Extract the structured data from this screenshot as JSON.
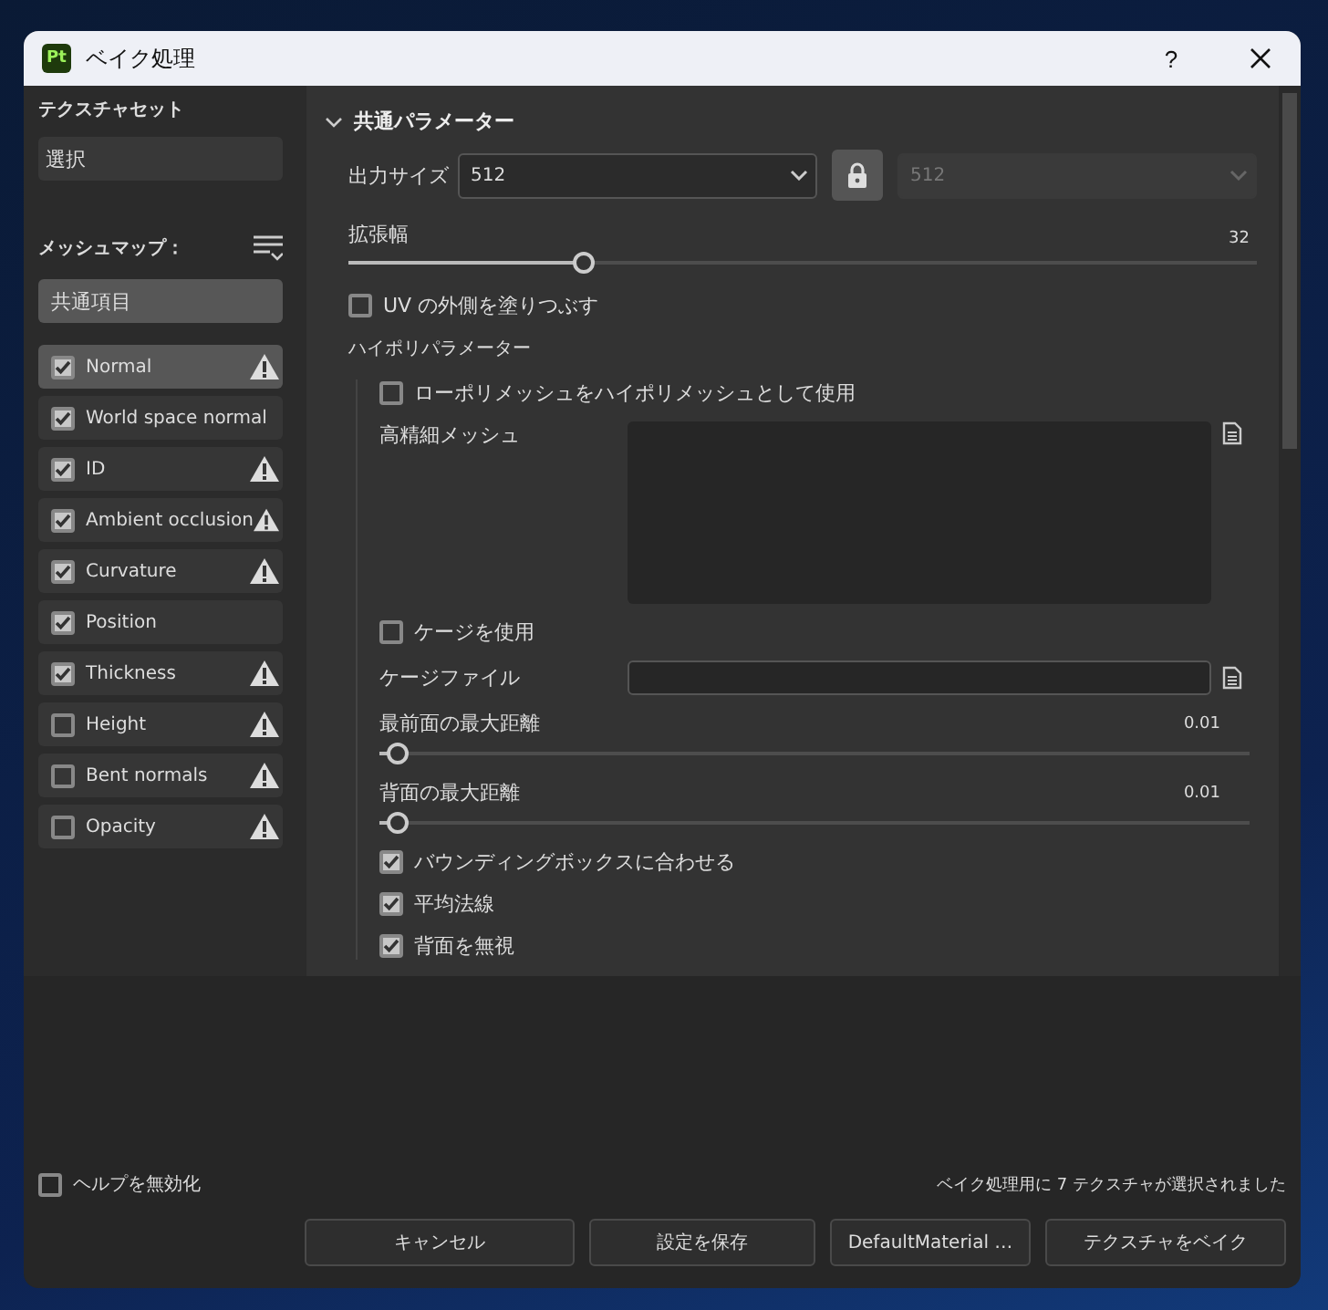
{
  "window": {
    "title": "ベイク処理",
    "logo": "Pt",
    "help": "?"
  },
  "sidebar": {
    "texture_set_label": "テクスチャセット",
    "texture_set_value": "選択",
    "mesh_maps_label": "メッシュマップ：",
    "common_item": {
      "label": "共通項目",
      "selected": true
    },
    "maps": [
      {
        "label": "Normal",
        "checked": true,
        "selected": true,
        "warning": true
      },
      {
        "label": "World space normal",
        "checked": true,
        "selected": false,
        "warning": false
      },
      {
        "label": "ID",
        "checked": true,
        "selected": false,
        "warning": true
      },
      {
        "label": "Ambient occlusion",
        "checked": true,
        "selected": false,
        "warning": true
      },
      {
        "label": "Curvature",
        "checked": true,
        "selected": false,
        "warning": true
      },
      {
        "label": "Position",
        "checked": true,
        "selected": false,
        "warning": false
      },
      {
        "label": "Thickness",
        "checked": true,
        "selected": false,
        "warning": true
      },
      {
        "label": "Height",
        "checked": false,
        "selected": false,
        "warning": true
      },
      {
        "label": "Bent normals",
        "checked": false,
        "selected": false,
        "warning": true
      },
      {
        "label": "Opacity",
        "checked": false,
        "selected": false,
        "warning": true
      }
    ]
  },
  "section": {
    "title": "共通パラメーター",
    "expanded": true
  },
  "output_size": {
    "label": "出力サイズ",
    "value": "512",
    "locked": true,
    "linked_value": "512"
  },
  "dilation": {
    "label": "拡張幅",
    "value": "32",
    "level": 0.26
  },
  "fill_uv": {
    "label": "UV の外側を塗りつぶす",
    "checked": false
  },
  "high_poly": {
    "title": "ハイポリパラメーター",
    "use_low_as_high": {
      "label": "ローポリメッシュをハイポリメッシュとして使用",
      "checked": false
    },
    "mesh_label": "高精細メッシュ",
    "use_cage": {
      "label": "ケージを使用",
      "checked": false
    },
    "cage_file_label": "ケージファイル",
    "distances": [
      {
        "label": "最前面の最大距離",
        "value": "0.01",
        "level": 0.02
      },
      {
        "label": "背面の最大距離",
        "value": "0.01",
        "level": 0.02
      }
    ],
    "options": [
      {
        "label": "バウンディングボックスに合わせる",
        "checked": true
      },
      {
        "label": "平均法線",
        "checked": true
      },
      {
        "label": "背面を無視",
        "checked": true
      }
    ]
  },
  "footer": {
    "disable_help": {
      "label": "ヘルプを無効化",
      "checked": false
    },
    "status": "ベイク処理用に 7 テクスチャが選択されました",
    "buttons": [
      "キャンセル",
      "設定を保存",
      "DefaultMaterial …",
      "テクスチャをベイク"
    ]
  }
}
